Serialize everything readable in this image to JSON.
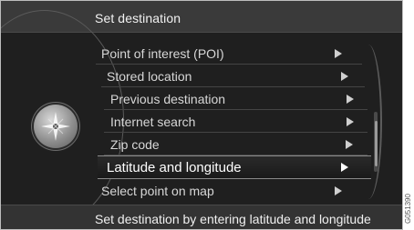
{
  "header": {
    "title": "Set destination"
  },
  "menu": {
    "items": [
      {
        "label": "Point of interest (POI)",
        "selected": false
      },
      {
        "label": "Stored location",
        "selected": false
      },
      {
        "label": "Previous destination",
        "selected": false
      },
      {
        "label": "Internet search",
        "selected": false
      },
      {
        "label": "Zip code",
        "selected": false
      },
      {
        "label": "Latitude and longitude",
        "selected": true
      },
      {
        "label": "Select point on map",
        "selected": false
      }
    ]
  },
  "status": {
    "text": "Set destination by entering latitude and longitude"
  },
  "figure_ref": "G051390",
  "icons": {
    "navigation": "compass-icon",
    "submenu": "arrow-right-icon"
  },
  "colors": {
    "background": "#1f1f1f",
    "text": "#d7d7d7",
    "selected_text": "#ffffff"
  }
}
